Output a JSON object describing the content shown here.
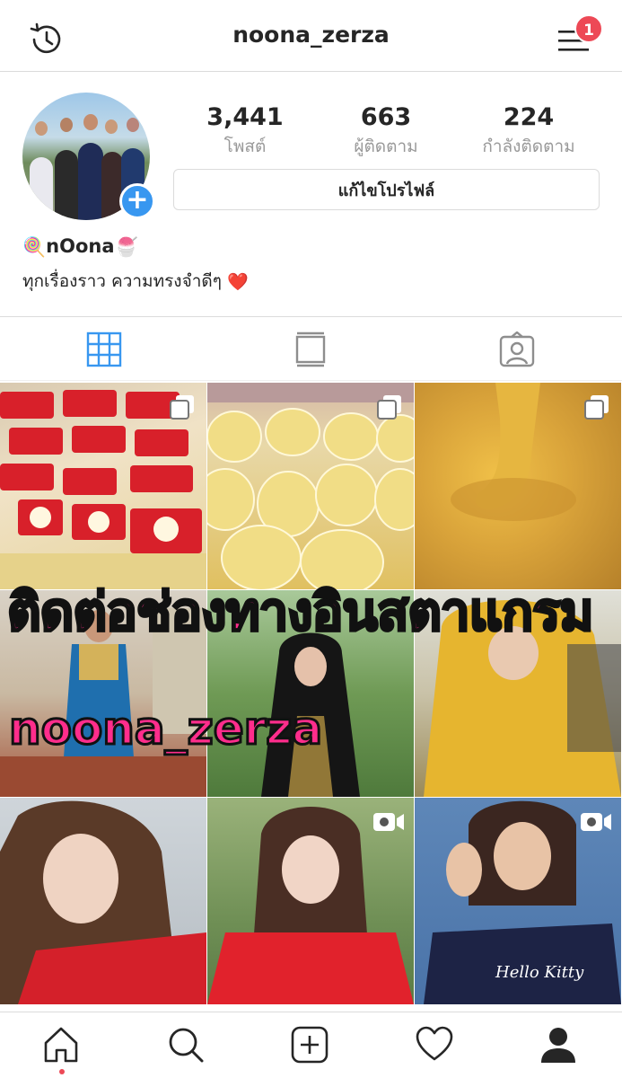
{
  "header": {
    "username": "noona_zerza",
    "notification_count": "1",
    "history_icon": "history-icon",
    "menu_icon": "hamburger-menu-icon"
  },
  "profile": {
    "stats": [
      {
        "value": "3,441",
        "label": "โพสต์"
      },
      {
        "value": "663",
        "label": "ผู้ติดตาม"
      },
      {
        "value": "224",
        "label": "กำลังติดตาม"
      }
    ],
    "edit_button": "แก้ไขโปรไฟล์",
    "display_name": "nOona",
    "display_name_emoji_left": "🍭",
    "display_name_emoji_right": "🍧",
    "bio": "ทุกเรื่องราว ความทรงจำดีๆ",
    "bio_emoji": "❤️"
  },
  "tabs": [
    {
      "icon": "grid-icon",
      "active": true
    },
    {
      "icon": "feed-icon",
      "active": false
    },
    {
      "icon": "tagged-icon",
      "active": false
    }
  ],
  "overlay": {
    "line1": "ติดต่อช่องทางอินสตาแกรม",
    "line2": "noona_zerza"
  },
  "posts": [
    {
      "kind": "multi",
      "subject": "red-packaged-snacks"
    },
    {
      "kind": "multi",
      "subject": "plastic-bags-yellow"
    },
    {
      "kind": "multi",
      "subject": "golden-syrup"
    },
    {
      "kind": "photo",
      "subject": "woman-blue-dress"
    },
    {
      "kind": "photo",
      "subject": "woman-hijab-garden"
    },
    {
      "kind": "photo",
      "subject": "woman-yellow-car"
    },
    {
      "kind": "photo",
      "subject": "woman-red-shirt"
    },
    {
      "kind": "video",
      "subject": "woman-red-shirt-wink"
    },
    {
      "kind": "video",
      "subject": "woman-ok-sign"
    }
  ],
  "bottom_nav": [
    "home-icon",
    "search-icon",
    "add-post-icon",
    "heart-icon",
    "profile-icon"
  ],
  "colors": {
    "accent": "#3897f0",
    "badge": "#ed4956",
    "overlay_text": "#ff2d8c"
  }
}
